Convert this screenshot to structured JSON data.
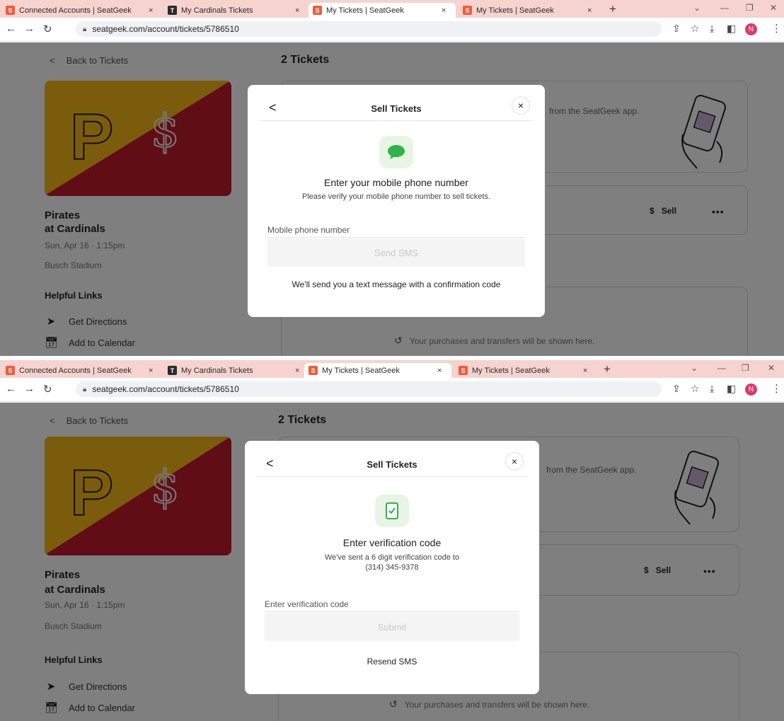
{
  "browser": {
    "tabs": [
      {
        "label": "Connected Accounts | SeatGeek",
        "favicon": "S",
        "favicon_color": "#f25a3c"
      },
      {
        "label": "My Cardinals Tickets",
        "favicon": "T",
        "favicon_color": "#2b2b2b"
      },
      {
        "label": "My Tickets | SeatGeek",
        "favicon": "S",
        "favicon_color": "#f25a3c"
      },
      {
        "label": "My Tickets | SeatGeek",
        "favicon": "S",
        "favicon_color": "#f25a3c"
      }
    ],
    "close_glyph": "×",
    "new_tab_glyph": "+",
    "url": "seatgeek.com/account/tickets/5786510",
    "profile_initial": "N",
    "profile_color": "#d93b6b"
  },
  "page": {
    "back_label": "Back to Tickets",
    "tickets_count": "2 Tickets",
    "event": {
      "away_team": "Pirates",
      "home_team_line": "at Cardinals",
      "datetime": "Sun, Apr 16 · 1:15pm",
      "venue": "Busch Stadium"
    },
    "helpful_links_title": "Helpful Links",
    "links": [
      "Get Directions",
      "Add to Calendar"
    ],
    "app_card_text": "from the SeatGeek app.",
    "sell_label": "Sell",
    "sell_symbol": "$",
    "more_glyph": "•••",
    "history_text": "Your purchases and transfers will be shown here."
  },
  "modal1": {
    "title": "Sell Tickets",
    "back_glyph": "<",
    "close_glyph": "×",
    "heading": "Enter your mobile phone number",
    "subtext": "Please verify your mobile phone number to sell tickets.",
    "input_placeholder": "Mobile phone number",
    "primary_label": "Send SMS",
    "footer_text": "We'll send you a text message with a confirmation code",
    "icon": "chat-bubble-icon"
  },
  "modal2": {
    "title": "Sell Tickets",
    "back_glyph": "<",
    "close_glyph": "×",
    "heading": "Enter verification code",
    "subtext_line1": "We've sent a 6 digit verification code to",
    "subtext_line2": "(314) 345-9378",
    "input_placeholder": "Enter verification code",
    "primary_label": "Submit",
    "footer_text": "Resend SMS",
    "icon": "phone-check-icon"
  },
  "colors": {
    "tabbar": "#f6d3cf",
    "accent_green": "#2fb34a",
    "icon_bg": "#e8f5e4",
    "pirates_gold": "#f7b81a",
    "cardinals_red": "#c01a2c"
  }
}
